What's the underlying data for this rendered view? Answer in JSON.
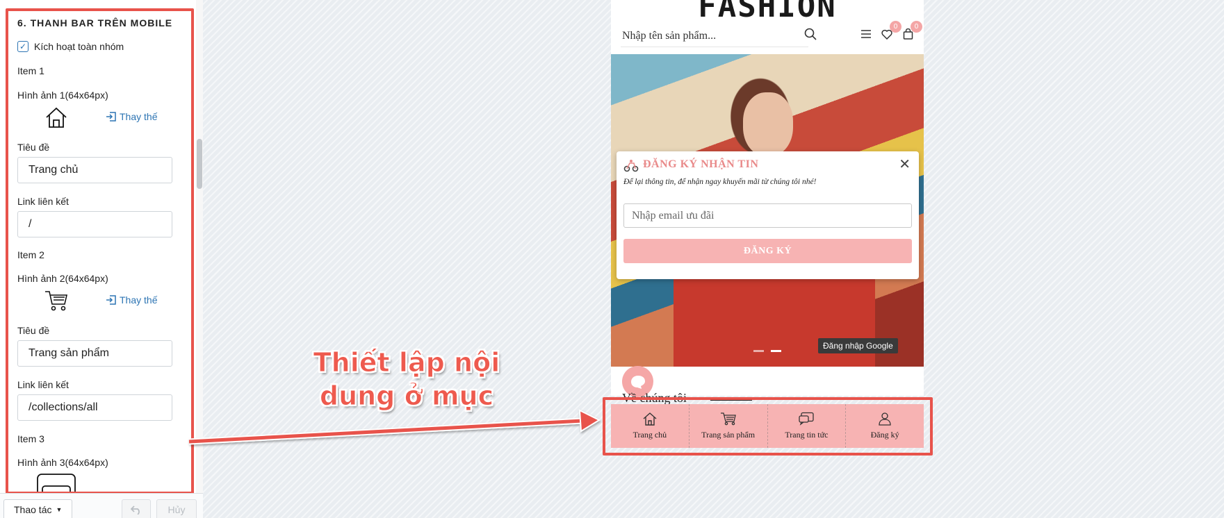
{
  "settings": {
    "section_title": "6. THANH BAR TRÊN MOBILE",
    "enable_all_label": "Kích hoạt toàn nhóm",
    "enable_all_checked": true,
    "replace_label": "Thay thế",
    "items": [
      {
        "heading": "Item 1",
        "image_label": "Hình ảnh 1(64x64px)",
        "image_icon": "home-icon",
        "title_label": "Tiêu đề",
        "title_value": "Trang chủ",
        "link_label": "Link liên kết",
        "link_value": "/"
      },
      {
        "heading": "Item 2",
        "image_label": "Hình ảnh 2(64x64px)",
        "image_icon": "cart-icon",
        "title_label": "Tiêu đề",
        "title_value": "Trang sản phẩm",
        "link_label": "Link liên kết",
        "link_value": "/collections/all"
      },
      {
        "heading": "Item 3",
        "image_label": "Hình ảnh 3(64x64px)",
        "image_icon": "chat-icon"
      }
    ],
    "actions_label": "Thao tác",
    "cancel_label": "Hủy"
  },
  "preview": {
    "logo": "FASHION",
    "search_placeholder": "Nhập tên sản phẩm...",
    "wishlist_count": "0",
    "cart_count": "0",
    "google_login": "Đăng nhập Google",
    "popup": {
      "title": "ĐĂNG KÝ NHẬN TIN",
      "description": "Để lại thông tin, để nhận ngay khuyến mãi từ chúng tôi nhé!",
      "email_placeholder": "Nhập email ưu đãi",
      "submit_label": "ĐĂNG KÝ"
    },
    "about_heading": "Về chúng tôi",
    "mobile_bar": [
      {
        "label": "Trang chủ",
        "icon": "home-icon"
      },
      {
        "label": "Trang sản phẩm",
        "icon": "cart-icon"
      },
      {
        "label": "Trang tin tức",
        "icon": "chat-icon"
      },
      {
        "label": "Đăng ký",
        "icon": "user-icon"
      }
    ]
  },
  "annotation": {
    "line1": "Thiết lập nội",
    "line2": "dung ở mục",
    "color": "#e8534b"
  }
}
